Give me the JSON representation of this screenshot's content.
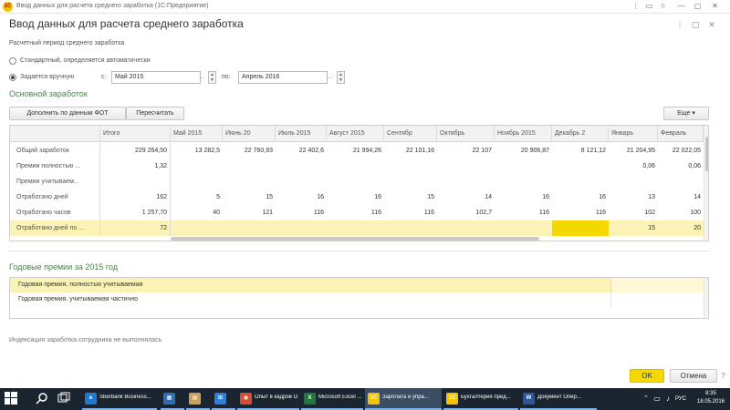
{
  "window": {
    "title": "Ввод данных для расчета среднего заработка  (1С:Предприятие)",
    "controls": [
      "⋮",
      "▭",
      "☆",
      "—",
      "▢",
      "✕"
    ]
  },
  "form": {
    "title": "Ввод данных для расчета среднего заработка",
    "controls": [
      "⋮",
      "▢",
      "✕"
    ]
  },
  "period": {
    "label": "Расчетный период среднего заработка",
    "option_standard": "Стандартный, определяется автоматически",
    "option_manual": "Задается вручную",
    "from_label": "с:",
    "from_value": "Май 2015",
    "to_label": "по:",
    "to_value": "Апрель 2016",
    "dots": "...",
    "spin_up": "▲",
    "spin_down": "▼"
  },
  "earnings": {
    "section_title": "Основной заработок",
    "fill_button": "Дополнить по данным ФОТ",
    "recalc_button": "Пересчитать",
    "more_button": "Еще",
    "more_arrow": "▾",
    "columns": [
      "",
      "Итого",
      "Май 2015",
      "Июнь 20",
      "Июль 2015",
      "Август 2015",
      "Сентябр",
      "Октябрь",
      "Ноябрь 2015",
      "Декабрь 2",
      "Январь",
      "Февраль"
    ],
    "rows": [
      {
        "label": "Общий заработок",
        "total": "229 264,50",
        "values": [
          "13 282,5",
          "22 760,93",
          "22 402,6",
          "21 994,26",
          "22 101,16",
          "22 107",
          "20 906,87",
          "8 121,12",
          "21 204,95",
          "22 022,05"
        ]
      },
      {
        "label": "Премии полностью ...",
        "total": "1,32",
        "values": [
          "",
          "",
          "",
          "",
          "",
          "",
          "",
          "",
          "0,06",
          "0,06"
        ]
      },
      {
        "label": "Премии учитываем...",
        "total": "",
        "values": [
          "",
          "",
          "",
          "",
          "",
          "",
          "",
          "",
          "",
          ""
        ]
      },
      {
        "label": "Отработано дней",
        "total": "162",
        "values": [
          "5",
          "15",
          "16",
          "16",
          "15",
          "14",
          "16",
          "16",
          "13",
          "14"
        ]
      },
      {
        "label": "Отработано часов",
        "total": "1 257,70",
        "values": [
          "40",
          "121",
          "116",
          "116",
          "116",
          "102,7",
          "116",
          "116",
          "102",
          "100"
        ]
      },
      {
        "label": "Отработано дней по ...",
        "total": "72",
        "values": [
          "",
          "",
          "",
          "",
          "",
          "",
          "",
          "",
          "15",
          "20"
        ]
      }
    ]
  },
  "bonuses": {
    "section_title": "Годовые премии за 2015 год",
    "items": [
      "Годовая премия, полностью учитываемая",
      "Годовая премия, учитываемая частично"
    ]
  },
  "footer": {
    "indexation_text": "Индексация заработка сотрудника не выполнялась",
    "ok": "OK",
    "cancel": "Отмена",
    "help": "?"
  },
  "taskbar": {
    "start_icon": "windows-start-icon",
    "apps": [
      {
        "label": "Sberbank Business...",
        "color": "#1e7bd0",
        "icon": "e"
      },
      {
        "label": "",
        "color": "#2f6db5",
        "icon": "▦"
      },
      {
        "label": "",
        "color": "#caa25a",
        "icon": "▤"
      },
      {
        "label": "",
        "color": "#2a7de1",
        "icon": "⊞"
      },
      {
        "label": "Опыт в кадров ООО...",
        "color": "#d94c33",
        "icon": "◉"
      },
      {
        "label": "Microsoft Excel ...",
        "color": "#1d7a3a",
        "icon": "X"
      },
      {
        "label": "Зарплата и упра...",
        "color": "#f5c400",
        "icon": "1С"
      },
      {
        "label": "Бухгалтерия пред...",
        "color": "#f5c400",
        "icon": "1С"
      },
      {
        "label": "Документ Опер...",
        "color": "#2b579a",
        "icon": "W"
      }
    ],
    "language": "РУС",
    "time": "8:35",
    "date": "18.05.2016"
  }
}
